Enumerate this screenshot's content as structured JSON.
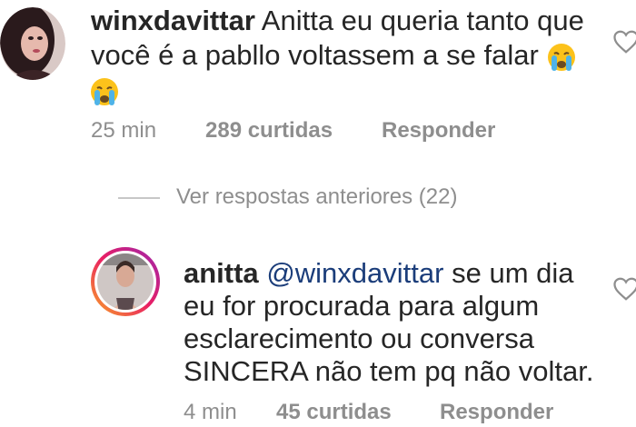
{
  "comment": {
    "username": "winxdavittar",
    "text_line1": "Anitta eu queria tanto que",
    "text_line2": "você é a pabllo voltassem a se falar",
    "emoji_icon": "crying-face-icon",
    "time": "25 min",
    "likes": "289 curtidas",
    "reply_label": "Responder"
  },
  "view_previous": {
    "label": "Ver respostas anteriores (22)"
  },
  "reply": {
    "username": "anitta",
    "mention": "@winxdavittar",
    "text_line1_rest": "se um dia",
    "text_line2": "eu for procurada para algum",
    "text_line3": "esclarecimento ou conversa",
    "text_line4": "SINCERA não tem pq não voltar.",
    "time": "4 min",
    "likes": "45 curtidas",
    "reply_label": "Responder"
  },
  "colors": {
    "text": "#262626",
    "secondary": "#8e8e8e",
    "story_ring_gradient": [
      "#f9a825",
      "#e91e63",
      "#9c27b0"
    ]
  }
}
